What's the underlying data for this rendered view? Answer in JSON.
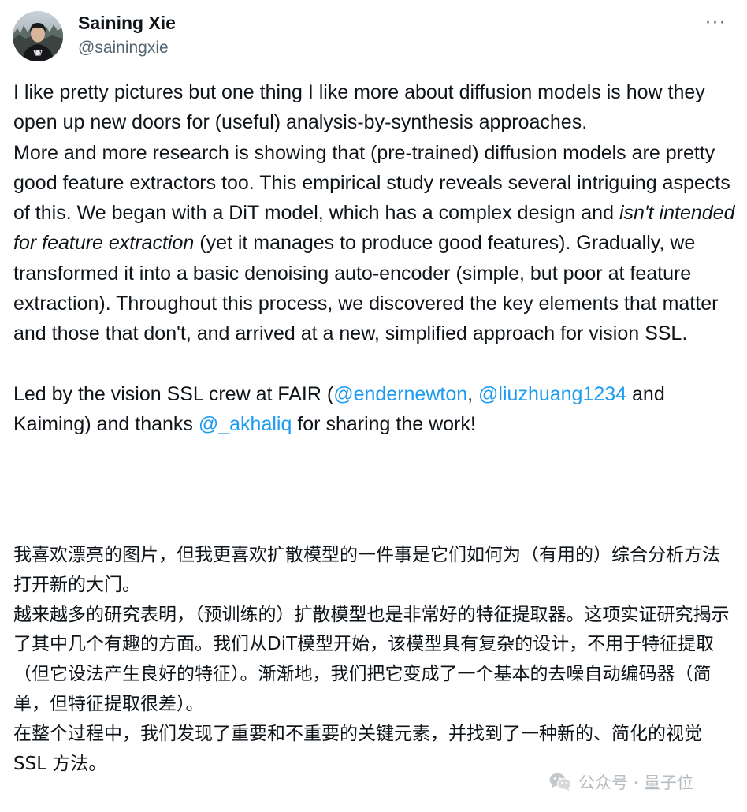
{
  "author": {
    "name": "Saining Xie",
    "handle": "@sainingxie",
    "more_icon": "more-horizontal-icon",
    "more_label": "···"
  },
  "tweet": {
    "p1": "I like pretty pictures but one thing I like more about diffusion models is how they open up new doors for (useful) analysis-by-synthesis approaches.",
    "p2_a": "More and more research is showing that (pre-trained) diffusion models are pretty good feature extractors too. This empirical study reveals several intriguing aspects of this. We began with a DiT model, which has a complex design and ",
    "p2_italic": "isn't intended for feature extraction",
    "p2_b": " (yet it manages to produce good features). Gradually, we transformed it into a basic denoising auto-encoder (simple, but poor at feature extraction). Throughout this process, we discovered the key elements that matter and those that don't, and arrived at a new, simplified approach for vision SSL.",
    "p3_a": "Led by the vision SSL crew at FAIR (",
    "mention1": "@endernewton",
    "p3_b": ", ",
    "mention2": "@liuzhuang1234",
    "p3_c": " and Kaiming) and thanks ",
    "mention3": "@_akhaliq",
    "p3_d": " for sharing the work!"
  },
  "translation": {
    "p1": "我喜欢漂亮的图片，但我更喜欢扩散模型的一件事是它们如何为（有用的）综合分析方法打开新的大门。",
    "p2": "越来越多的研究表明，（预训练的）扩散模型也是非常好的特征提取器。这项实证研究揭示了其中几个有趣的方面。我们从DiT模型开始，该模型具有复杂的设计，不用于特征提取（但它设法产生良好的特征）。渐渐地，我们把它变成了一个基本的去噪自动编码器（简单，但特征提取很差）。",
    "p3": "在整个过程中，我们发现了重要和不重要的关键元素，并找到了一种新的、简化的视觉 SSL 方法。"
  },
  "watermark": {
    "icon": "wechat-icon",
    "text": "公众号 · 量子位"
  },
  "colors": {
    "text": "#0f1419",
    "secondary": "#536471",
    "link": "#1d9bf0",
    "watermark": "#b7bcc1"
  }
}
